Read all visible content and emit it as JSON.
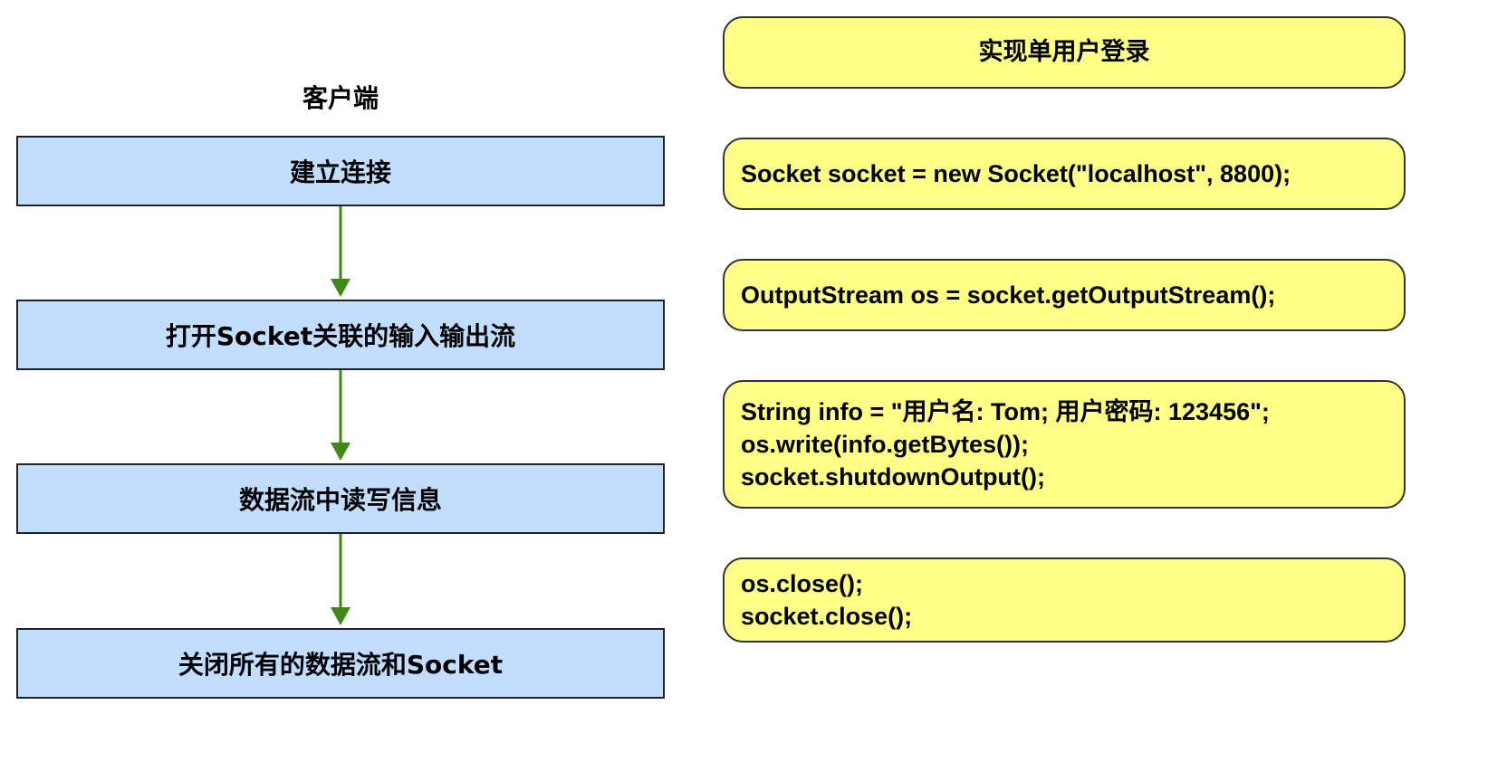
{
  "colors": {
    "step_fill": "#c2deff",
    "code_fill": "#ffff88",
    "arrow": "#3d8a16"
  },
  "client": {
    "title": "客户端",
    "steps": [
      "建立连接",
      "打开Socket关联的输入输出流",
      "数据流中读写信息",
      "关闭所有的数据流和Socket"
    ]
  },
  "code_panel": {
    "title": "实现单用户登录",
    "blocks": [
      [
        "Socket socket = new Socket(\"localhost\", 8800);"
      ],
      [
        "OutputStream os = socket.getOutputStream();"
      ],
      [
        "String info = \"用户名: Tom; 用户密码: 123456\";",
        "os.write(info.getBytes());",
        "socket.shutdownOutput();"
      ],
      [
        "os.close();",
        "socket.close();"
      ]
    ]
  }
}
